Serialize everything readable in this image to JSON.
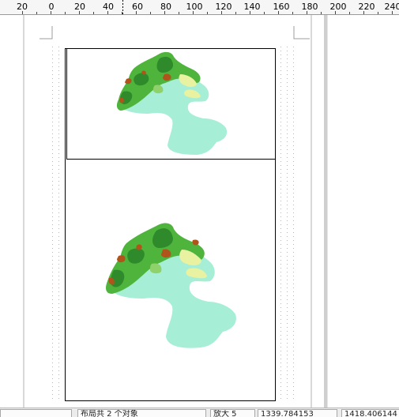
{
  "ruler": {
    "labels": [
      "20",
      "0",
      "20",
      "40",
      "60",
      "80",
      "100",
      "120",
      "140",
      "160",
      "180",
      "200",
      "220",
      "240"
    ]
  },
  "statusbar": {
    "object_count": "布局共 2 个对象",
    "zoom_label": "放大 5",
    "coord_x": "1339.784153",
    "coord_y": "1418.406144"
  },
  "colors": {
    "mountain_dark": "#2e8a2a",
    "mountain_mid": "#4fb43c",
    "mountain_light": "#8fd16a",
    "foothill": "#e8f2a0",
    "plain": "#a6eed6",
    "peak_brown": "#b0541c"
  }
}
